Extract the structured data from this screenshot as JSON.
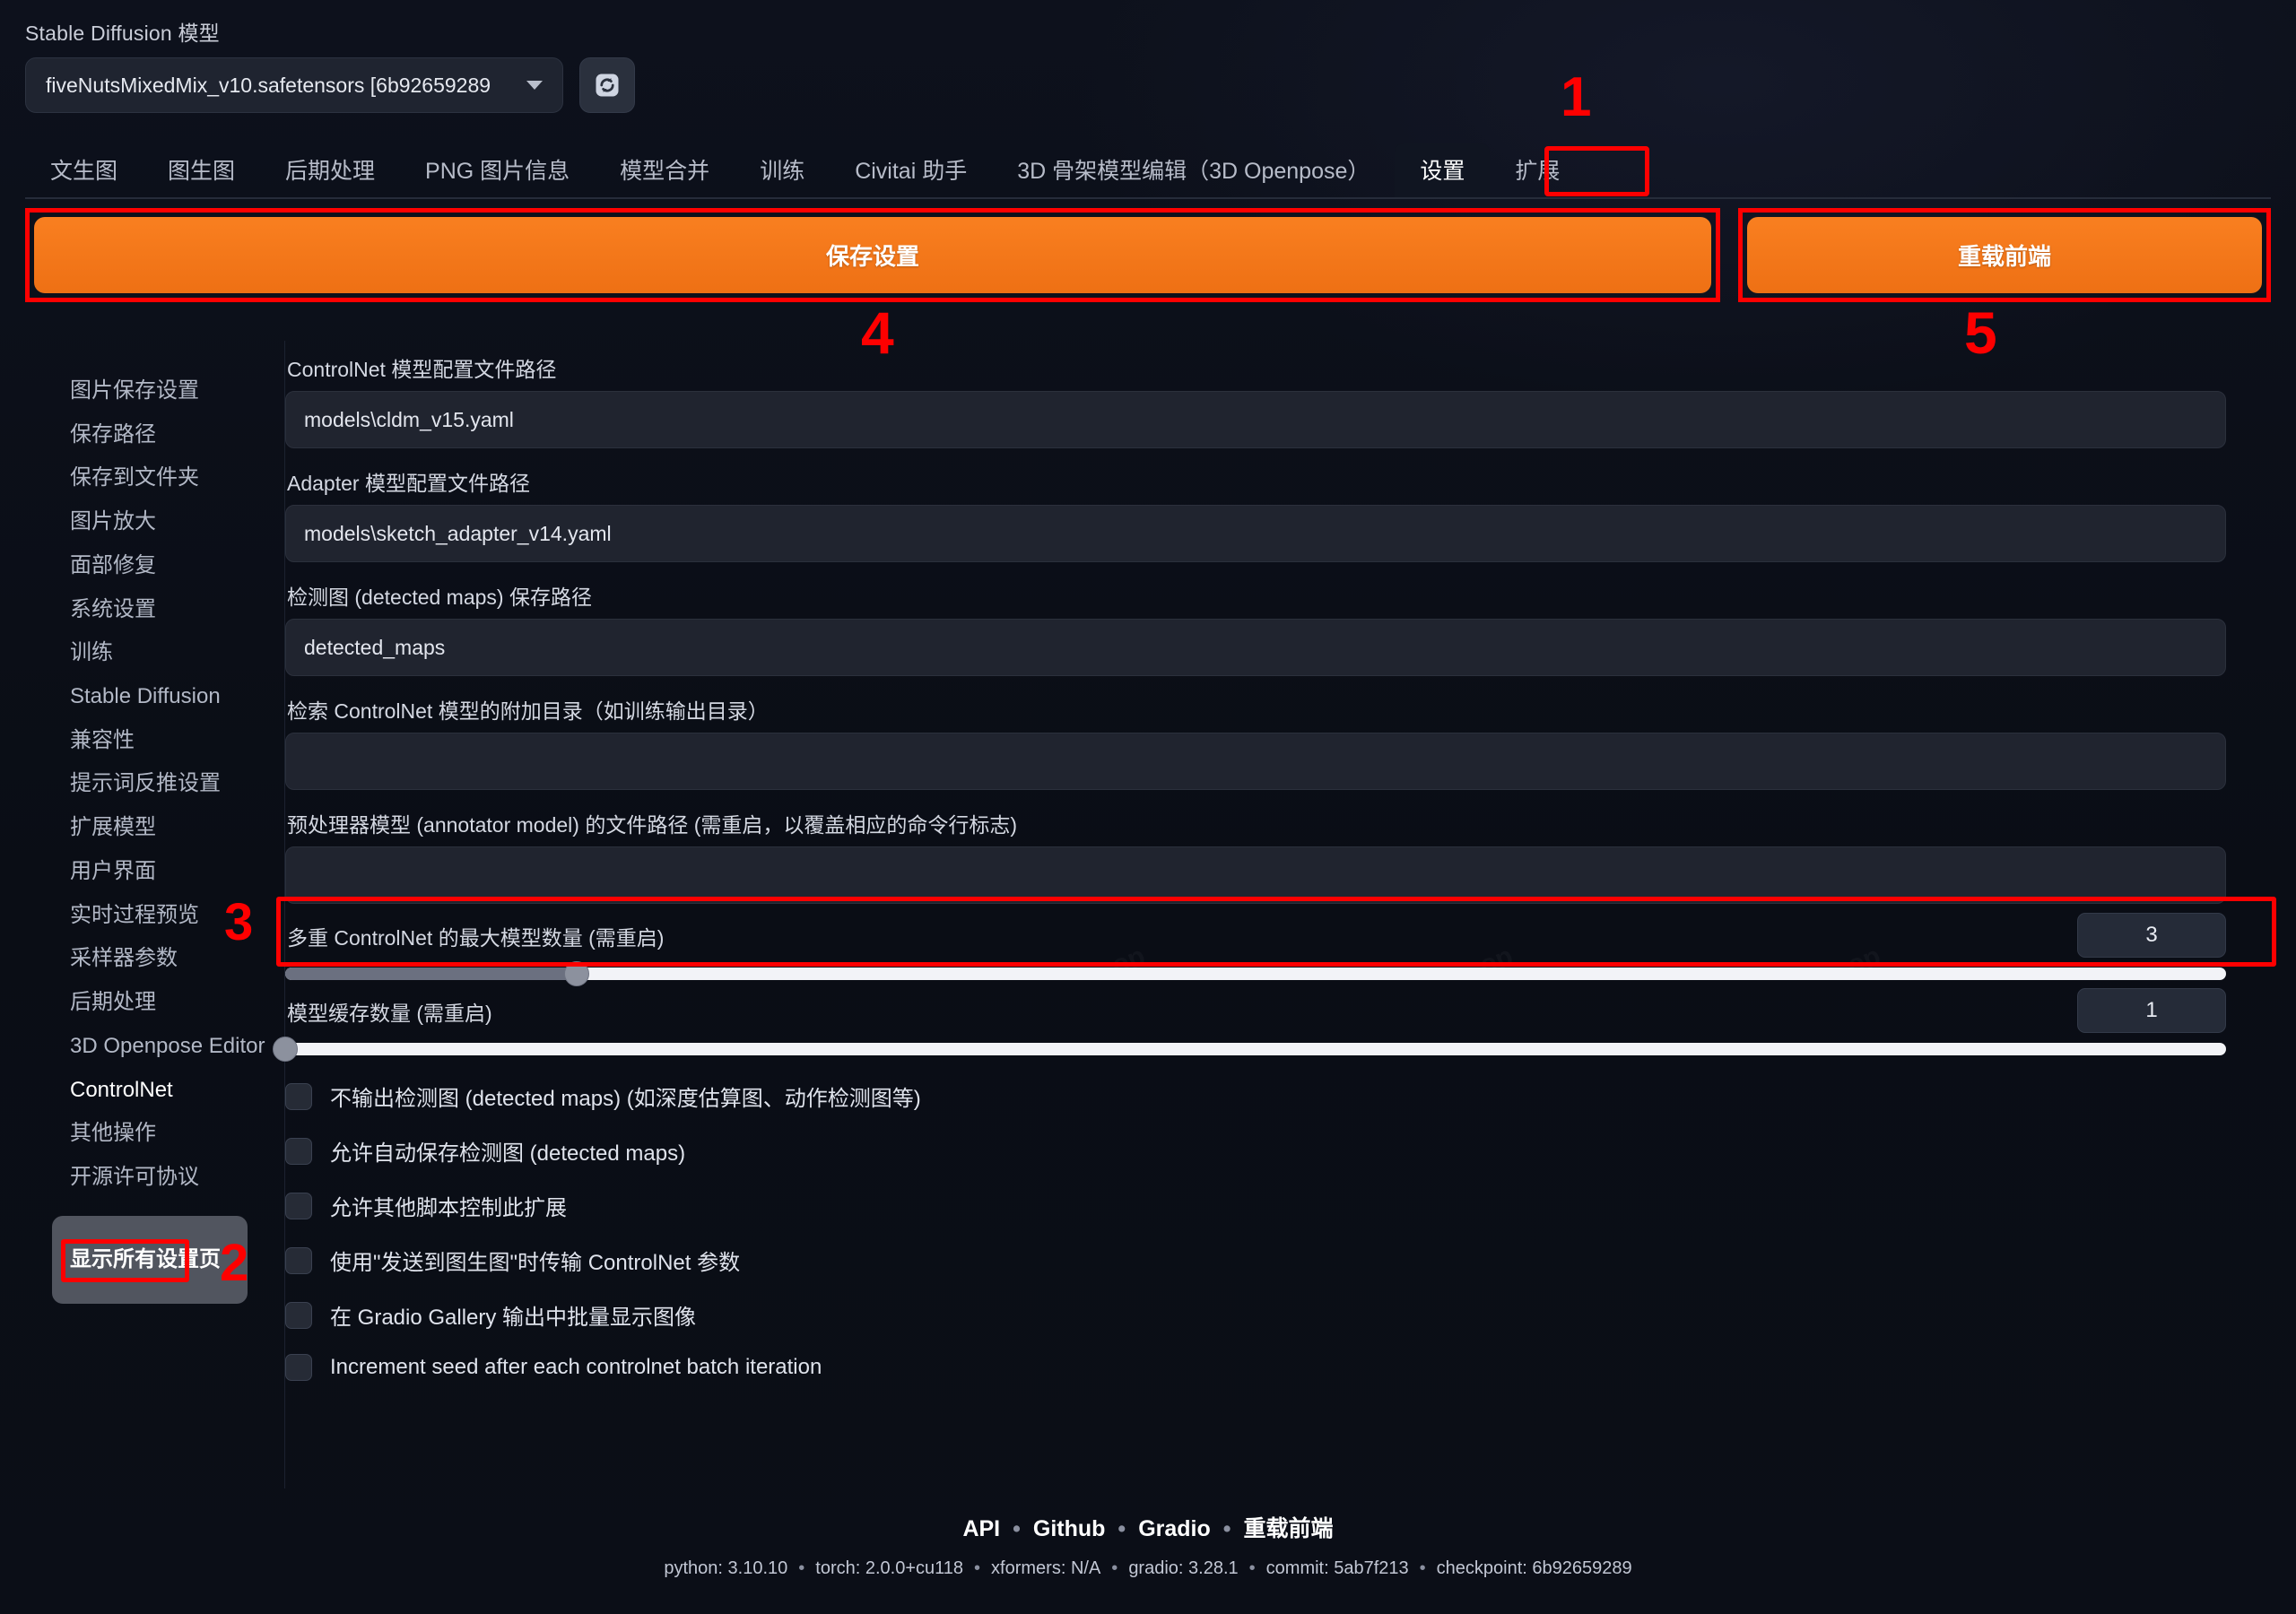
{
  "model": {
    "label": "Stable Diffusion 模型",
    "value": "fiveNutsMixedMix_v10.safetensors [6b92659289",
    "refresh_icon": "refresh-icon"
  },
  "tabs": [
    {
      "label": "文生图",
      "active": false
    },
    {
      "label": "图生图",
      "active": false
    },
    {
      "label": "后期处理",
      "active": false
    },
    {
      "label": "PNG 图片信息",
      "active": false
    },
    {
      "label": "模型合并",
      "active": false
    },
    {
      "label": "训练",
      "active": false
    },
    {
      "label": "Civitai 助手",
      "active": false
    },
    {
      "label": "3D 骨架模型编辑（3D Openpose）",
      "active": false
    },
    {
      "label": "设置",
      "active": true
    },
    {
      "label": "扩展",
      "active": false
    }
  ],
  "actions": {
    "save_label": "保存设置",
    "reload_label": "重载前端"
  },
  "annotations": {
    "one": "1",
    "two": "2",
    "three": "3",
    "four": "4",
    "five": "5"
  },
  "sidebar": {
    "items": [
      {
        "label": "图片保存设置"
      },
      {
        "label": "保存路径"
      },
      {
        "label": "保存到文件夹"
      },
      {
        "label": "图片放大"
      },
      {
        "label": "面部修复"
      },
      {
        "label": "系统设置"
      },
      {
        "label": "训练"
      },
      {
        "label": "Stable Diffusion"
      },
      {
        "label": "兼容性"
      },
      {
        "label": "提示词反推设置"
      },
      {
        "label": "扩展模型"
      },
      {
        "label": "用户界面"
      },
      {
        "label": "实时过程预览"
      },
      {
        "label": "采样器参数"
      },
      {
        "label": "后期处理"
      },
      {
        "label": "3D Openpose Editor"
      },
      {
        "label": "ControlNet"
      },
      {
        "label": "其他操作"
      },
      {
        "label": "开源许可协议"
      }
    ],
    "show_all_label": "显示所有设置页"
  },
  "main": {
    "text_fields": [
      {
        "label": "ControlNet 模型配置文件路径",
        "value": "models\\cldm_v15.yaml"
      },
      {
        "label": "Adapter 模型配置文件路径",
        "value": "models\\sketch_adapter_v14.yaml"
      },
      {
        "label": "检测图 (detected maps) 保存路径",
        "value": "detected_maps"
      },
      {
        "label": "检索 ControlNet 模型的附加目录（如训练输出目录）",
        "value": ""
      },
      {
        "label": "预处理器模型 (annotator model) 的文件路径 (需重启，以覆盖相应的命令行标志)",
        "value": ""
      }
    ],
    "sliders": [
      {
        "label": "多重 ControlNet 的最大模型数量 (需重启)",
        "value": "3",
        "percent": 15
      },
      {
        "label": "模型缓存数量 (需重启)",
        "value": "1",
        "percent": 0
      }
    ],
    "checkboxes": [
      {
        "label": "不输出检测图 (detected maps) (如深度估算图、动作检测图等)",
        "checked": false
      },
      {
        "label": "允许自动保存检测图 (detected maps)",
        "checked": false
      },
      {
        "label": "允许其他脚本控制此扩展",
        "checked": false
      },
      {
        "label": "使用\"发送到图生图\"时传输 ControlNet 参数",
        "checked": false
      },
      {
        "label": "在 Gradio Gallery 输出中批量显示图像",
        "checked": false
      },
      {
        "label": "Increment seed after each controlnet batch iteration",
        "checked": false
      }
    ]
  },
  "footer": {
    "links": [
      "API",
      "Github",
      "Gradio",
      "重载前端"
    ],
    "separator": "•",
    "meta": [
      "python: 3.10.10",
      "torch: 2.0.0+cu118",
      "xformers: N/A",
      "gradio: 3.28.1",
      "commit: 5ab7f213",
      "checkpoint: 6b92659289"
    ]
  },
  "colors": {
    "accent_orange": "#f0750f",
    "highlight_red": "#fe0000",
    "background": "#0b0e17"
  }
}
